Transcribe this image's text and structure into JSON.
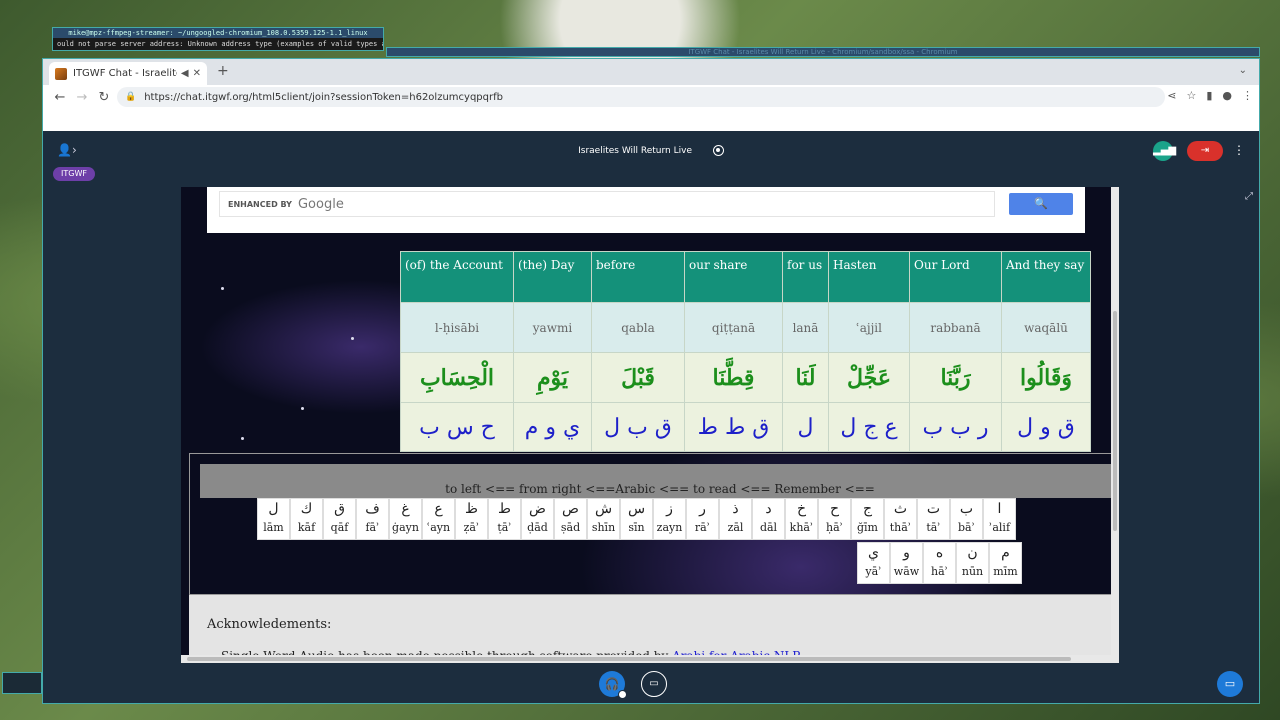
{
  "desktop": {
    "terminal_title": "mike@mpz-ffmpeg-streamer: ~/ungoogled-chromium_108.0.5359.125-1.1_linux",
    "terminal_line": "ould not parse server address: Unknown address type (examples of valid types are",
    "bg_window_title": "ITGWF Chat - Israelites Will Return Live - Chromium/sandbox/ssa - Chromium"
  },
  "browser": {
    "tab_title": "ITGWF Chat - Israelites",
    "new_tab": "+",
    "url": "https://chat.itgwf.org/html5client/join?sessionToken=h62olzumcyqpqrfb"
  },
  "app": {
    "room_title": "Israelites Will Return Live",
    "badge": "ITGWF"
  },
  "search": {
    "enhanced_by": "ENHANCED BY",
    "google": "Google"
  },
  "vocab": {
    "columns": [
      {
        "english": "(of) the Account",
        "translit": "l-ḥisābi",
        "arabic": "الْحِسَابِ",
        "letters": "ح س ب"
      },
      {
        "english": "(the) Day",
        "translit": "yawmi",
        "arabic": "يَوْمِ",
        "letters": "ي و م"
      },
      {
        "english": "before",
        "translit": "qabla",
        "arabic": "قَبْلَ",
        "letters": "ق ب ل"
      },
      {
        "english": "our share",
        "translit": "qiṭṭanā",
        "arabic": "قِطَّنَا",
        "letters": "ق ط ط"
      },
      {
        "english": "for us",
        "translit": "lanā",
        "arabic": "لَنَا",
        "letters": "ل"
      },
      {
        "english": "Hasten",
        "translit": "ʿajjil",
        "arabic": "عَجِّلْ",
        "letters": "ع ج ل"
      },
      {
        "english": "Our Lord",
        "translit": "rabbanā",
        "arabic": "رَبَّنَا",
        "letters": "ر ب ب"
      },
      {
        "english": "And they say",
        "translit": "waqālū",
        "arabic": "وَقَالُوا",
        "letters": "ق و ل"
      }
    ]
  },
  "reminder": "to left <== from right <==Arabic <== to read <== Remember <==",
  "alphabet_row1": [
    {
      "ch": "ا",
      "name": "ʾalif"
    },
    {
      "ch": "ب",
      "name": "bāʾ"
    },
    {
      "ch": "ت",
      "name": "tāʾ"
    },
    {
      "ch": "ث",
      "name": "thāʾ"
    },
    {
      "ch": "ج",
      "name": "ğīm"
    },
    {
      "ch": "ح",
      "name": "ḥāʾ"
    },
    {
      "ch": "خ",
      "name": "khāʾ"
    },
    {
      "ch": "د",
      "name": "dāl"
    },
    {
      "ch": "ذ",
      "name": "zāl"
    },
    {
      "ch": "ر",
      "name": "rāʾ"
    },
    {
      "ch": "ز",
      "name": "zayn"
    },
    {
      "ch": "س",
      "name": "sīn"
    },
    {
      "ch": "ش",
      "name": "shīn"
    },
    {
      "ch": "ص",
      "name": "ṣād"
    },
    {
      "ch": "ض",
      "name": "ḍād"
    },
    {
      "ch": "ط",
      "name": "ṭāʾ"
    },
    {
      "ch": "ظ",
      "name": "ẓāʾ"
    },
    {
      "ch": "ع",
      "name": "ʿayn"
    },
    {
      "ch": "غ",
      "name": "ġayn"
    },
    {
      "ch": "ف",
      "name": "fāʾ"
    },
    {
      "ch": "ق",
      "name": "qāf"
    },
    {
      "ch": "ك",
      "name": "kāf"
    },
    {
      "ch": "ل",
      "name": "lām"
    }
  ],
  "alphabet_row2": [
    {
      "ch": "م",
      "name": "mīm"
    },
    {
      "ch": "ن",
      "name": "nūn"
    },
    {
      "ch": "ه",
      "name": "hāʾ"
    },
    {
      "ch": "و",
      "name": "wāw"
    },
    {
      "ch": "ي",
      "name": "yāʾ"
    }
  ],
  "ack": {
    "heading": "Acknowledements:",
    "text": "Single Word Audio has been made possible through software provided by",
    "link": "Arabi for Arabic NLP"
  },
  "colors": {
    "english_row": "#14917a",
    "arabic_text": "#1c8f1c",
    "letters_text": "#1d20c9",
    "leave_button": "#d9312b",
    "badge": "#6d3fa8"
  }
}
